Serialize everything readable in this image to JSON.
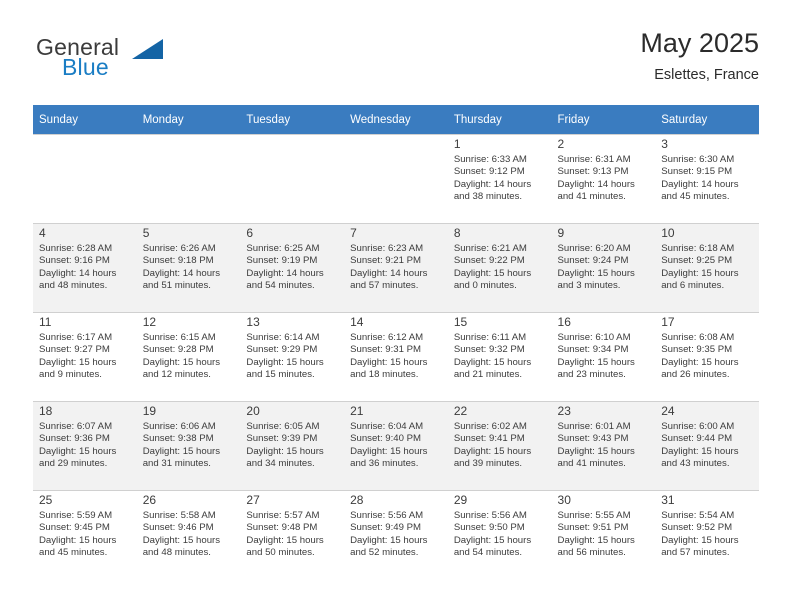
{
  "brand": {
    "name_top": "General",
    "name_bottom": "Blue",
    "triangle_color": "#1464a5",
    "blue_color": "#1a7dc4"
  },
  "header": {
    "title": "May 2025",
    "subtitle": "Eslettes, France"
  },
  "theme": {
    "header_bg": "#3a7cc0",
    "header_text": "#ffffff",
    "row_alt_bg": "#f2f2f2",
    "grid_line": "#d0d0d0",
    "text": "#3c3c3c"
  },
  "calendar": {
    "weekday_headers": [
      "Sunday",
      "Monday",
      "Tuesday",
      "Wednesday",
      "Thursday",
      "Friday",
      "Saturday"
    ],
    "weeks": [
      [
        {
          "day": "",
          "lines": []
        },
        {
          "day": "",
          "lines": []
        },
        {
          "day": "",
          "lines": []
        },
        {
          "day": "",
          "lines": []
        },
        {
          "day": "1",
          "lines": [
            "Sunrise: 6:33 AM",
            "Sunset: 9:12 PM",
            "Daylight: 14 hours",
            "and 38 minutes."
          ]
        },
        {
          "day": "2",
          "lines": [
            "Sunrise: 6:31 AM",
            "Sunset: 9:13 PM",
            "Daylight: 14 hours",
            "and 41 minutes."
          ]
        },
        {
          "day": "3",
          "lines": [
            "Sunrise: 6:30 AM",
            "Sunset: 9:15 PM",
            "Daylight: 14 hours",
            "and 45 minutes."
          ]
        }
      ],
      [
        {
          "day": "4",
          "lines": [
            "Sunrise: 6:28 AM",
            "Sunset: 9:16 PM",
            "Daylight: 14 hours",
            "and 48 minutes."
          ]
        },
        {
          "day": "5",
          "lines": [
            "Sunrise: 6:26 AM",
            "Sunset: 9:18 PM",
            "Daylight: 14 hours",
            "and 51 minutes."
          ]
        },
        {
          "day": "6",
          "lines": [
            "Sunrise: 6:25 AM",
            "Sunset: 9:19 PM",
            "Daylight: 14 hours",
            "and 54 minutes."
          ]
        },
        {
          "day": "7",
          "lines": [
            "Sunrise: 6:23 AM",
            "Sunset: 9:21 PM",
            "Daylight: 14 hours",
            "and 57 minutes."
          ]
        },
        {
          "day": "8",
          "lines": [
            "Sunrise: 6:21 AM",
            "Sunset: 9:22 PM",
            "Daylight: 15 hours",
            "and 0 minutes."
          ]
        },
        {
          "day": "9",
          "lines": [
            "Sunrise: 6:20 AM",
            "Sunset: 9:24 PM",
            "Daylight: 15 hours",
            "and 3 minutes."
          ]
        },
        {
          "day": "10",
          "lines": [
            "Sunrise: 6:18 AM",
            "Sunset: 9:25 PM",
            "Daylight: 15 hours",
            "and 6 minutes."
          ]
        }
      ],
      [
        {
          "day": "11",
          "lines": [
            "Sunrise: 6:17 AM",
            "Sunset: 9:27 PM",
            "Daylight: 15 hours",
            "and 9 minutes."
          ]
        },
        {
          "day": "12",
          "lines": [
            "Sunrise: 6:15 AM",
            "Sunset: 9:28 PM",
            "Daylight: 15 hours",
            "and 12 minutes."
          ]
        },
        {
          "day": "13",
          "lines": [
            "Sunrise: 6:14 AM",
            "Sunset: 9:29 PM",
            "Daylight: 15 hours",
            "and 15 minutes."
          ]
        },
        {
          "day": "14",
          "lines": [
            "Sunrise: 6:12 AM",
            "Sunset: 9:31 PM",
            "Daylight: 15 hours",
            "and 18 minutes."
          ]
        },
        {
          "day": "15",
          "lines": [
            "Sunrise: 6:11 AM",
            "Sunset: 9:32 PM",
            "Daylight: 15 hours",
            "and 21 minutes."
          ]
        },
        {
          "day": "16",
          "lines": [
            "Sunrise: 6:10 AM",
            "Sunset: 9:34 PM",
            "Daylight: 15 hours",
            "and 23 minutes."
          ]
        },
        {
          "day": "17",
          "lines": [
            "Sunrise: 6:08 AM",
            "Sunset: 9:35 PM",
            "Daylight: 15 hours",
            "and 26 minutes."
          ]
        }
      ],
      [
        {
          "day": "18",
          "lines": [
            "Sunrise: 6:07 AM",
            "Sunset: 9:36 PM",
            "Daylight: 15 hours",
            "and 29 minutes."
          ]
        },
        {
          "day": "19",
          "lines": [
            "Sunrise: 6:06 AM",
            "Sunset: 9:38 PM",
            "Daylight: 15 hours",
            "and 31 minutes."
          ]
        },
        {
          "day": "20",
          "lines": [
            "Sunrise: 6:05 AM",
            "Sunset: 9:39 PM",
            "Daylight: 15 hours",
            "and 34 minutes."
          ]
        },
        {
          "day": "21",
          "lines": [
            "Sunrise: 6:04 AM",
            "Sunset: 9:40 PM",
            "Daylight: 15 hours",
            "and 36 minutes."
          ]
        },
        {
          "day": "22",
          "lines": [
            "Sunrise: 6:02 AM",
            "Sunset: 9:41 PM",
            "Daylight: 15 hours",
            "and 39 minutes."
          ]
        },
        {
          "day": "23",
          "lines": [
            "Sunrise: 6:01 AM",
            "Sunset: 9:43 PM",
            "Daylight: 15 hours",
            "and 41 minutes."
          ]
        },
        {
          "day": "24",
          "lines": [
            "Sunrise: 6:00 AM",
            "Sunset: 9:44 PM",
            "Daylight: 15 hours",
            "and 43 minutes."
          ]
        }
      ],
      [
        {
          "day": "25",
          "lines": [
            "Sunrise: 5:59 AM",
            "Sunset: 9:45 PM",
            "Daylight: 15 hours",
            "and 45 minutes."
          ]
        },
        {
          "day": "26",
          "lines": [
            "Sunrise: 5:58 AM",
            "Sunset: 9:46 PM",
            "Daylight: 15 hours",
            "and 48 minutes."
          ]
        },
        {
          "day": "27",
          "lines": [
            "Sunrise: 5:57 AM",
            "Sunset: 9:48 PM",
            "Daylight: 15 hours",
            "and 50 minutes."
          ]
        },
        {
          "day": "28",
          "lines": [
            "Sunrise: 5:56 AM",
            "Sunset: 9:49 PM",
            "Daylight: 15 hours",
            "and 52 minutes."
          ]
        },
        {
          "day": "29",
          "lines": [
            "Sunrise: 5:56 AM",
            "Sunset: 9:50 PM",
            "Daylight: 15 hours",
            "and 54 minutes."
          ]
        },
        {
          "day": "30",
          "lines": [
            "Sunrise: 5:55 AM",
            "Sunset: 9:51 PM",
            "Daylight: 15 hours",
            "and 56 minutes."
          ]
        },
        {
          "day": "31",
          "lines": [
            "Sunrise: 5:54 AM",
            "Sunset: 9:52 PM",
            "Daylight: 15 hours",
            "and 57 minutes."
          ]
        }
      ]
    ]
  }
}
